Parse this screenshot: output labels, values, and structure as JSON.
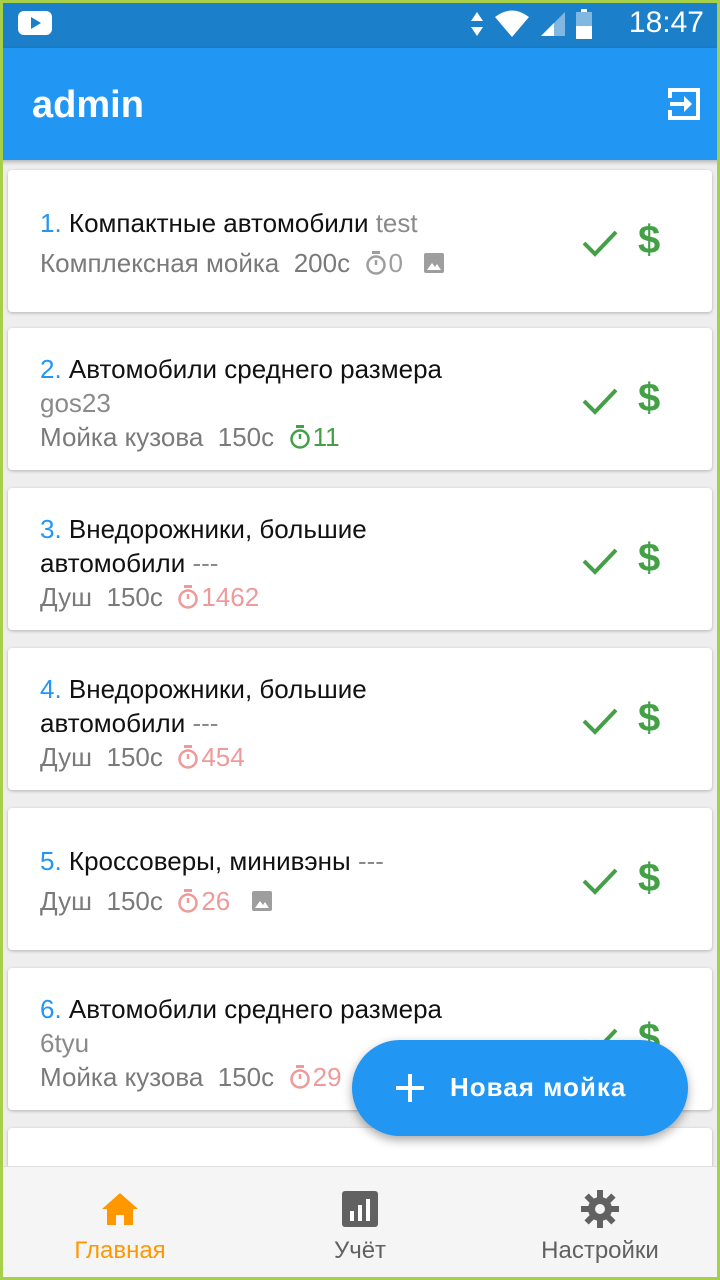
{
  "status_bar": {
    "time": "18:47"
  },
  "app_bar": {
    "title": "admin",
    "logout_icon": "logout-icon"
  },
  "orders": [
    {
      "number": "1.",
      "car_type": "Компактные автомобили",
      "plate": "test",
      "service": "Комплексная мойка",
      "price": "200с",
      "timer": "0",
      "timer_state": "idle",
      "has_image": true
    },
    {
      "number": "2.",
      "car_type": "Автомобили среднего размера",
      "plate": "gos23",
      "service": "Мойка кузова",
      "price": "150с",
      "timer": "11",
      "timer_state": "ok",
      "has_image": false
    },
    {
      "number": "3.",
      "car_type_line1": "Внедорожники, большие",
      "car_type_line2": "автомобили",
      "plate": "---",
      "service": "Душ",
      "price": "150с",
      "timer": "1462",
      "timer_state": "overdue",
      "has_image": false
    },
    {
      "number": "4.",
      "car_type_line1": "Внедорожники, большие",
      "car_type_line2": "автомобили",
      "plate": "---",
      "service": "Душ",
      "price": "150с",
      "timer": "454",
      "timer_state": "overdue",
      "has_image": false
    },
    {
      "number": "5.",
      "car_type": "Кроссоверы, минивэны",
      "plate": "---",
      "service": "Душ",
      "price": "150с",
      "timer": "26",
      "timer_state": "overdue",
      "has_image": true
    },
    {
      "number": "6.",
      "car_type": "Автомобили среднего размера",
      "plate": "6tyu",
      "service": "Мойка кузова",
      "price": "150с",
      "timer": "29",
      "timer_state": "overdue",
      "has_image": false
    }
  ],
  "actions": {
    "done_icon": "check-icon",
    "pay_symbol": "$"
  },
  "fab": {
    "label": "Новая мойка"
  },
  "bottom_nav": {
    "items": [
      {
        "label": "Главная",
        "icon": "home-icon",
        "active": true
      },
      {
        "label": "Учёт",
        "icon": "stats-icon",
        "active": false
      },
      {
        "label": "Настройки",
        "icon": "gear-icon",
        "active": false
      }
    ]
  },
  "colors": {
    "primary": "#2196f3",
    "accent_active": "#ff9800",
    "success": "#43a047",
    "overdue": "#ef9a9a",
    "status_bar": "#1b7fc9"
  }
}
